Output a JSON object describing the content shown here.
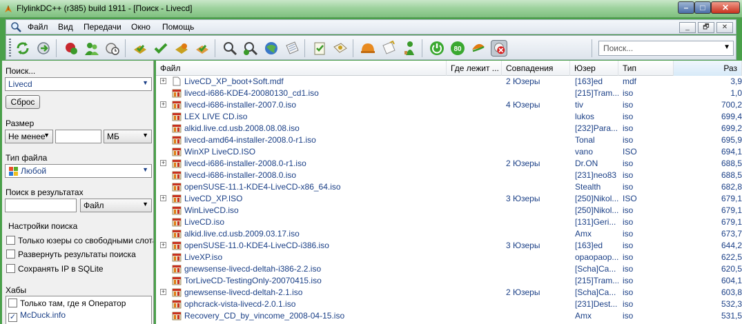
{
  "window": {
    "title": "FlylinkDC++ (r385) build 1911 - [Поиск - Livecd]",
    "min_glyph": "–",
    "max_glyph": "□",
    "close_glyph": "✕"
  },
  "menu": {
    "items": [
      "Файл",
      "Вид",
      "Передачи",
      "Окно",
      "Помощь"
    ],
    "mdi": [
      "_",
      "🗗",
      "✕"
    ]
  },
  "toolbar": {
    "search_placeholder": "Поиск...",
    "speed_badge": "80"
  },
  "left_panel": {
    "search_label": "Поиск...",
    "search_value": "Livecd",
    "reset_button": "Сброс",
    "size_label": "Размер",
    "size_mode": "Не менее",
    "size_value": "",
    "size_unit": "МБ",
    "file_type_label": "Тип файла",
    "file_type_value": "Любой",
    "search_in_results_label": "Поиск в результатах",
    "search_in_results_value": "",
    "search_in_results_field": "Файл",
    "settings_label": "Настройки поиска",
    "options": [
      {
        "label": "Только юзеры со свободными слотами",
        "checked": false
      },
      {
        "label": "Развернуть результаты поиска",
        "checked": false
      },
      {
        "label": "Сохранять IP в SQLite",
        "checked": false
      }
    ],
    "hubs_label": "Хабы",
    "hubs": [
      {
        "label": "Только там, где я Оператор",
        "checked": false
      },
      {
        "label": "McDuck.info",
        "checked": true
      }
    ]
  },
  "results": {
    "columns": [
      "Файл",
      "Где лежит ...",
      "Совпадения",
      "Юзер",
      "Тип",
      "Раз"
    ],
    "rows": [
      {
        "expand": true,
        "icon": "document-icon",
        "name": "LiveCD_XP_boot+Soft.mdf",
        "matches": "2 Юзеры",
        "user": "[163]ed",
        "type": "mdf",
        "size": "3,9"
      },
      {
        "expand": false,
        "icon": "archive-icon",
        "name": "livecd-i686-KDE4-20080130_cd1.iso",
        "matches": "",
        "user": "[215]Tram...",
        "type": "iso",
        "size": "1,0"
      },
      {
        "expand": true,
        "icon": "archive-icon",
        "name": "livecd-i686-installer-2007.0.iso",
        "matches": "4 Юзеры",
        "user": "tiv",
        "type": "iso",
        "size": "700,2"
      },
      {
        "expand": false,
        "icon": "archive-icon",
        "name": "LEX LIVE CD.iso",
        "matches": "",
        "user": "lukos",
        "type": "iso",
        "size": "699,4"
      },
      {
        "expand": false,
        "icon": "archive-icon",
        "name": "alkid.live.cd.usb.2008.08.08.iso",
        "matches": "",
        "user": "[232]Para...",
        "type": "iso",
        "size": "699,2"
      },
      {
        "expand": false,
        "icon": "archive-icon",
        "name": "livecd-amd64-installer-2008.0-r1.iso",
        "matches": "",
        "user": "Tonal",
        "type": "iso",
        "size": "695,9"
      },
      {
        "expand": false,
        "icon": "archive-icon",
        "name": "WinXP LiveCD.ISO",
        "matches": "",
        "user": "vano",
        "type": "ISO",
        "size": "694,1"
      },
      {
        "expand": true,
        "icon": "archive-icon",
        "name": "livecd-i686-installer-2008.0-r1.iso",
        "matches": "2 Юзеры",
        "user": "Dr.ON",
        "type": "iso",
        "size": "688,5"
      },
      {
        "expand": false,
        "icon": "archive-icon",
        "name": "livecd-i686-installer-2008.0.iso",
        "matches": "",
        "user": "[231]neo83",
        "type": "iso",
        "size": "688,5"
      },
      {
        "expand": false,
        "icon": "archive-icon",
        "name": "openSUSE-11.1-KDE4-LiveCD-x86_64.iso",
        "matches": "",
        "user": "Stealth",
        "type": "iso",
        "size": "682,8"
      },
      {
        "expand": true,
        "icon": "archive-icon",
        "name": "LiveCD_XP.ISO",
        "matches": "3 Юзеры",
        "user": "[250]Nikol...",
        "type": "ISO",
        "size": "679,1"
      },
      {
        "expand": false,
        "icon": "archive-icon",
        "name": "WinLiveCD.iso",
        "matches": "",
        "user": "[250]Nikol...",
        "type": "iso",
        "size": "679,1"
      },
      {
        "expand": false,
        "icon": "archive-icon",
        "name": "LiveCD.iso",
        "matches": "",
        "user": "[131]Geri...",
        "type": "iso",
        "size": "679,1"
      },
      {
        "expand": false,
        "icon": "archive-icon",
        "name": "alkid.live.cd.usb.2009.03.17.iso",
        "matches": "",
        "user": "Amx",
        "type": "iso",
        "size": "673,7"
      },
      {
        "expand": true,
        "icon": "archive-icon",
        "name": "openSUSE-11.0-KDE4-LiveCD-i386.iso",
        "matches": "3 Юзеры",
        "user": "[163]ed",
        "type": "iso",
        "size": "644,2"
      },
      {
        "expand": false,
        "icon": "archive-icon",
        "name": "LiveXP.iso",
        "matches": "",
        "user": "opaopaop...",
        "type": "iso",
        "size": "622,5"
      },
      {
        "expand": false,
        "icon": "archive-icon",
        "name": "gnewsense-livecd-deltah-i386-2.2.iso",
        "matches": "",
        "user": "[Scha]Ca...",
        "type": "iso",
        "size": "620,5"
      },
      {
        "expand": false,
        "icon": "archive-icon",
        "name": "TorLiveCD-TestingOnly-20070415.iso",
        "matches": "",
        "user": "[215]Tram...",
        "type": "iso",
        "size": "604,1"
      },
      {
        "expand": true,
        "icon": "archive-icon",
        "name": "gnewsense-livecd-deltah-2.1.iso",
        "matches": "2 Юзеры",
        "user": "[Scha]Ca...",
        "type": "iso",
        "size": "603,8"
      },
      {
        "expand": false,
        "icon": "archive-icon",
        "name": "ophcrack-vista-livecd-2.0.1.iso",
        "matches": "",
        "user": "[231]Dest...",
        "type": "iso",
        "size": "532,3"
      },
      {
        "expand": false,
        "icon": "archive-icon",
        "name": "Recovery_CD_by_vincome_2008-04-15.iso",
        "matches": "",
        "user": "Amx",
        "type": "iso",
        "size": "531,5"
      }
    ]
  }
}
